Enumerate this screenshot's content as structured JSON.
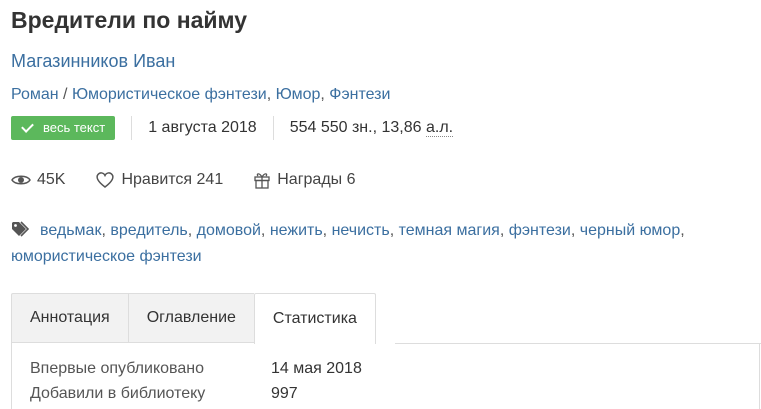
{
  "book": {
    "title": "Вредители по найму",
    "author": "Магазинников Иван",
    "genres": [
      "Роман",
      "Юмористическое фэнтези",
      "Юмор",
      "Фэнтези"
    ],
    "badge_label": "весь текст",
    "date": "1 августа 2018",
    "size_chars": "554 550 зн., 13,86",
    "size_unit": "а.л."
  },
  "stats": {
    "views": "45K",
    "likes_label": "Нравится",
    "likes_count": "241",
    "awards_label": "Награды",
    "awards_count": "6"
  },
  "tags": [
    "ведьмак",
    "вредитель",
    "домовой",
    "нежить",
    "нечисть",
    "темная магия",
    "фэнтези",
    "черный юмор",
    "юмористическое фэнтези"
  ],
  "tabs": [
    {
      "label": "Аннотация",
      "active": false
    },
    {
      "label": "Оглавление",
      "active": false
    },
    {
      "label": "Статистика",
      "active": true
    }
  ],
  "statistics_panel": [
    {
      "label": "Впервые опубликовано",
      "value": "14 мая 2018"
    },
    {
      "label": "Добавили в библиотеку",
      "value": "997"
    }
  ],
  "colors": {
    "link": "#3b6fa0",
    "badge": "#5cb85c",
    "text": "#333333"
  }
}
